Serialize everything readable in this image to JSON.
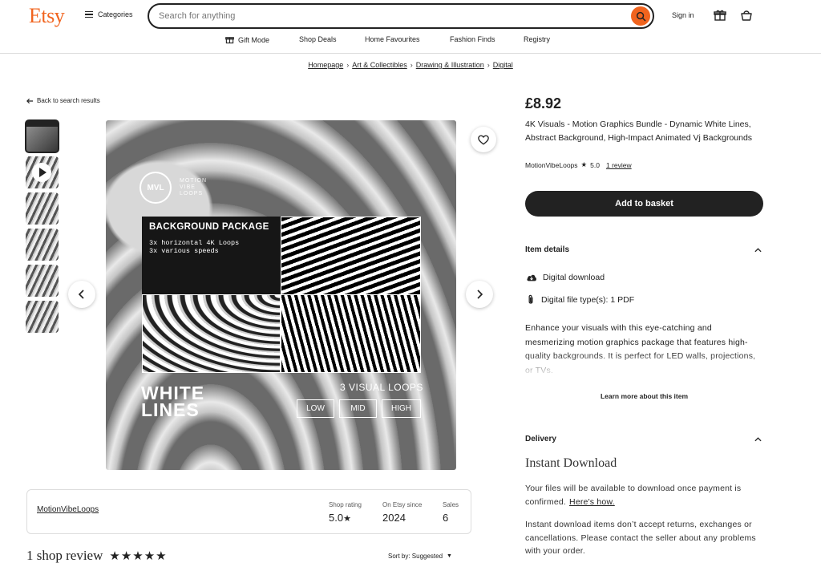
{
  "header": {
    "logo": "Etsy",
    "categories": "Categories",
    "search_placeholder": "Search for anything",
    "sign_in": "Sign in"
  },
  "subnav": [
    "Gift Mode",
    "Shop Deals",
    "Home Favourites",
    "Fashion Finds",
    "Registry"
  ],
  "breadcrumb": [
    "Homepage",
    "Art & Collectibles",
    "Drawing & Illustration",
    "Digital"
  ],
  "back_link": "Back to search results",
  "image": {
    "logo_text": "MVL",
    "logo_sub": [
      "MOTION",
      "VIBE",
      "LOOPS"
    ],
    "package_title": "BACKGROUND PACKAGE",
    "package_lines": [
      "3x horizontal 4K Loops",
      "3x various speeds"
    ],
    "headline_1": "WHITE",
    "headline_2": "LINES",
    "loops_label": "3 VISUAL LOOPS",
    "speeds": [
      "LOW",
      "MID",
      "HIGH"
    ]
  },
  "shop": {
    "name": "MotionVibeLoops",
    "rating_label": "Shop rating",
    "rating_value": "5.0",
    "since_label": "On Etsy since",
    "since_value": "2024",
    "sales_label": "Sales",
    "sales_value": "6"
  },
  "reviews": {
    "heading": "1 shop review",
    "stars": "★★★★★",
    "sort_label": "Sort by: Suggested"
  },
  "product": {
    "price": "£8.92",
    "title": "4K Visuals - Motion Graphics Bundle - Dynamic White Lines, Abstract Background, High-Impact Animated Vj Backgrounds",
    "seller": "MotionVibeLoops",
    "rating": "5.0",
    "review_count": "1 review",
    "add_to_basket": "Add to basket"
  },
  "item_details": {
    "heading": "Item details",
    "rows": [
      "Digital download",
      "Digital file type(s): 1 PDF"
    ],
    "description": "Enhance your visuals with this eye-catching and mesmerizing motion graphics package that features high-quality backgrounds. It is perfect for LED walls, projections, or TVs.",
    "learn_more": "Learn more about this item"
  },
  "delivery": {
    "heading": "Delivery",
    "title": "Instant Download",
    "text1": "Your files will be available to download once payment is confirmed.",
    "link": "Here's how.",
    "text2": "Instant download items don’t accept returns, exchanges or cancellations. Please contact the seller about any problems with your order."
  },
  "colors": {
    "brand": "#f1641e",
    "button": "#222222"
  }
}
